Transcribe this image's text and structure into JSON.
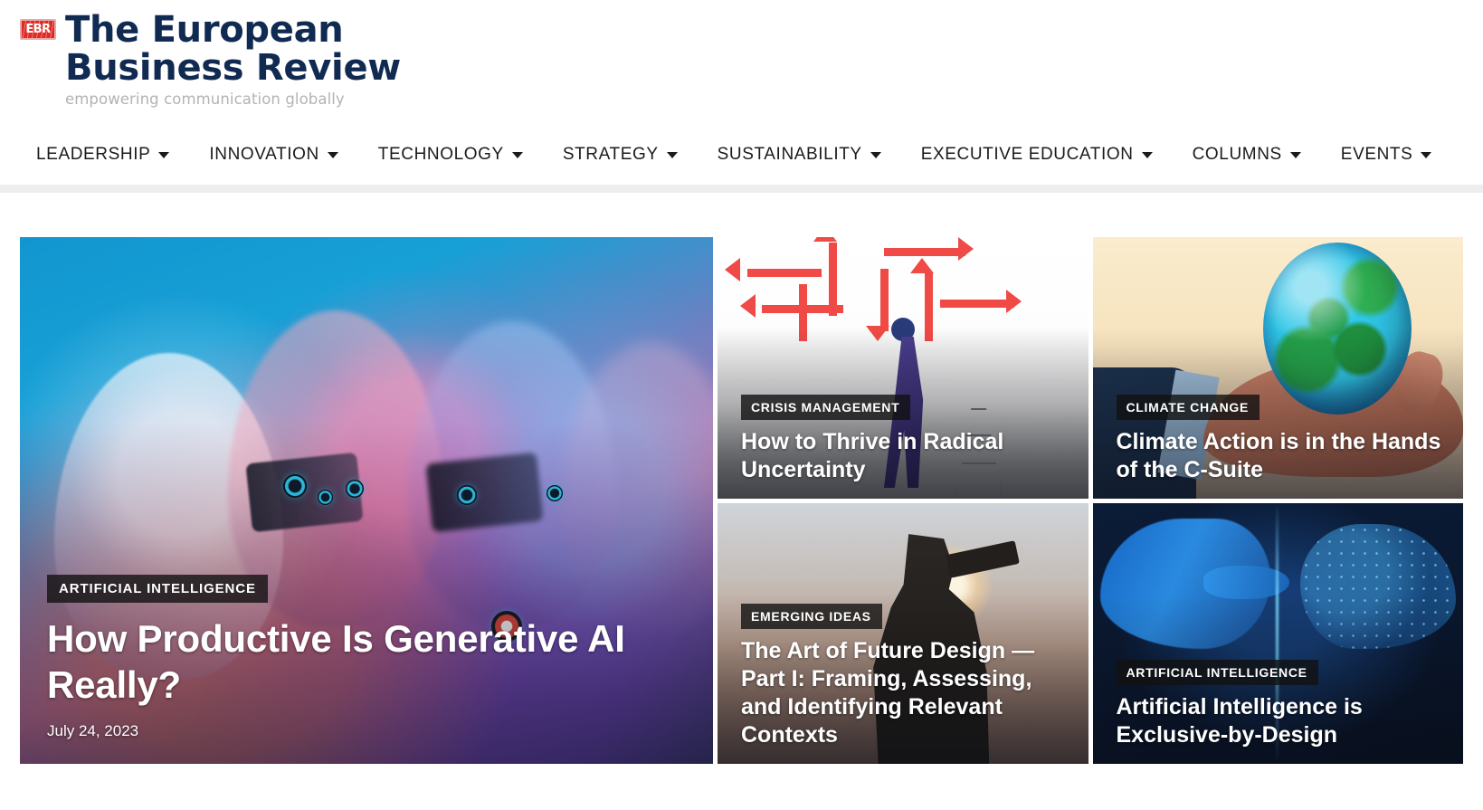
{
  "header": {
    "logo_mark_text": "EBR",
    "logo_line1": "The European",
    "logo_line2": "Business Review",
    "tagline": "empowering communication globally"
  },
  "nav": {
    "items": [
      {
        "label": "LEADERSHIP",
        "has_dropdown": true
      },
      {
        "label": "INNOVATION",
        "has_dropdown": true
      },
      {
        "label": "TECHNOLOGY",
        "has_dropdown": true
      },
      {
        "label": "STRATEGY",
        "has_dropdown": true
      },
      {
        "label": "SUSTAINABILITY",
        "has_dropdown": true
      },
      {
        "label": "EXECUTIVE EDUCATION",
        "has_dropdown": true
      },
      {
        "label": "COLUMNS",
        "has_dropdown": true
      },
      {
        "label": "EVENTS",
        "has_dropdown": true
      }
    ]
  },
  "featured": {
    "hero": {
      "category": "ARTIFICIAL INTELLIGENCE",
      "title": "How Productive Is Generative AI Really?",
      "date": "July 24, 2023",
      "image_alt": "robot-heads-gradient"
    },
    "cards": [
      {
        "category": "CRISIS MANAGEMENT",
        "title": "How to Thrive in Radical Uncertainty",
        "image_alt": "red-arrows-businessman-ladder"
      },
      {
        "category": "CLIMATE CHANGE",
        "title": "Climate Action is in the Hands of the C-Suite",
        "image_alt": "globe-held-in-hand"
      },
      {
        "category": "EMERGING IDEAS",
        "title": "The Art of Future Design — Part I: Framing, Assessing, and Identifying Relevant Contexts",
        "image_alt": "silhouette-with-binoculars-at-sunset"
      },
      {
        "category": "ARTIFICIAL INTELLIGENCE",
        "title": "Artificial Intelligence is Exclusive-by-Design",
        "image_alt": "blue-hand-touching-digital-hand"
      }
    ]
  },
  "colors": {
    "logo_navy": "#102a51",
    "logo_red": "#e02a26",
    "tagline_gray": "#b3b3b3",
    "nav_text": "#1b1b1b",
    "tag_background": "#121212",
    "page_background": "#ffffff",
    "nav_underband": "#eeeeee"
  }
}
